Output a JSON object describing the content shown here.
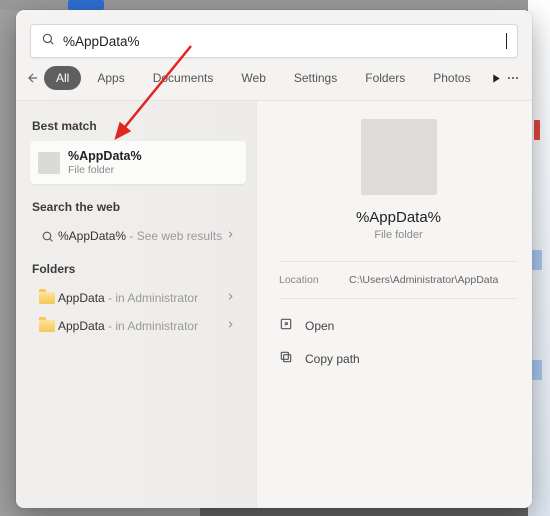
{
  "search": {
    "value": "%AppData%",
    "placeholder": ""
  },
  "filters": {
    "items": [
      {
        "label": "All"
      },
      {
        "label": "Apps"
      },
      {
        "label": "Documents"
      },
      {
        "label": "Web"
      },
      {
        "label": "Settings"
      },
      {
        "label": "Folders"
      },
      {
        "label": "Photos"
      }
    ],
    "active_index": 0
  },
  "sections": {
    "best_match_label": "Best match",
    "search_web_label": "Search the web",
    "folders_label": "Folders"
  },
  "best_match": {
    "title": "%AppData%",
    "subtitle": "File folder"
  },
  "web_result": {
    "prefix": "%AppData% ",
    "suffix": "- See web results"
  },
  "folders": [
    {
      "name": "AppData",
      "suffix": " - in Administrator"
    },
    {
      "name": "AppData",
      "suffix": " - in Administrator"
    }
  ],
  "detail": {
    "title": "%AppData%",
    "subtitle": "File folder",
    "location_label": "Location",
    "location_value": "C:\\Users\\Administrator\\AppData",
    "actions": {
      "open": "Open",
      "copy_path": "Copy path"
    }
  }
}
